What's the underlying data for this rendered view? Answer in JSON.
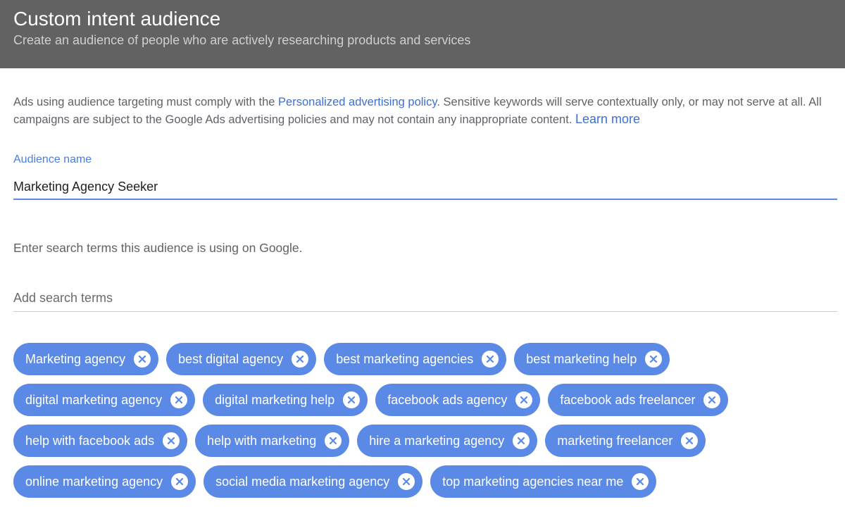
{
  "header": {
    "title": "Custom intent audience",
    "subtitle": "Create an audience of people who are actively researching products and services"
  },
  "policy": {
    "text_before": "Ads using audience targeting must comply with the ",
    "policy_link": "Personalized advertising policy",
    "text_after": ". Sensitive keywords will serve contextually only, or may not serve at all. All campaigns are subject to the Google Ads advertising policies and may not contain any inappropriate content. ",
    "learn_more": "Learn more"
  },
  "audience_name": {
    "label": "Audience name",
    "value": "Marketing Agency Seeker"
  },
  "search_terms": {
    "instruction": "Enter search terms this audience is using on Google.",
    "placeholder": "Add search terms",
    "chips": [
      "Marketing agency",
      "best digital agency",
      "best marketing agencies",
      "best marketing help",
      "digital marketing agency",
      "digital marketing help",
      "facebook ads agency",
      "facebook ads freelancer",
      "help with facebook ads",
      "help with marketing",
      "hire a marketing agency",
      "marketing freelancer",
      "online marketing agency",
      "social media marketing agency",
      "top marketing agencies near me"
    ],
    "chip_remove_icon": "close-circle-icon"
  },
  "colors": {
    "header_bg": "#626262",
    "accent": "#5b8ae6",
    "link": "#3c6fd6"
  }
}
